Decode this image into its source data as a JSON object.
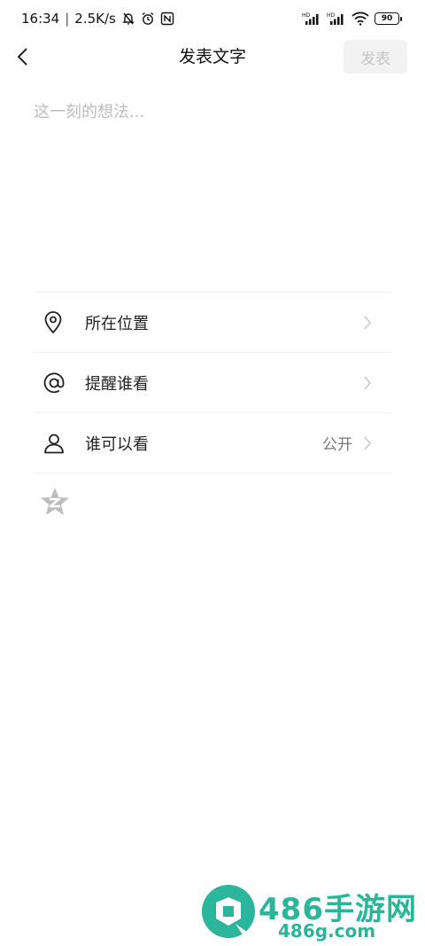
{
  "status_bar": {
    "time": "16:34",
    "network_speed": "2.5K/s",
    "battery_level": "90",
    "icons": [
      "bell-muted-icon",
      "alarm-icon",
      "nfc-icon",
      "signal-hd-icon",
      "signal-hd-icon",
      "wifi-icon",
      "battery-icon"
    ]
  },
  "header": {
    "title": "发表文字",
    "publish_label": "发表",
    "back_icon": "chevron-left-icon"
  },
  "editor": {
    "placeholder": "这一刻的想法..."
  },
  "options": [
    {
      "icon": "location-pin-icon",
      "label": "所在位置",
      "value": ""
    },
    {
      "icon": "at-sign-icon",
      "label": "提醒谁看",
      "value": ""
    },
    {
      "icon": "person-icon",
      "label": "谁可以看",
      "value": "公开"
    }
  ],
  "qzone": {
    "icon": "qzone-star-icon"
  },
  "watermark": {
    "title": "486手游网",
    "url": "486g.com"
  },
  "colors": {
    "accent": "#2bb59a",
    "publish_disabled_bg": "#f2f2f2",
    "publish_disabled_text": "#c6c6c6",
    "divider": "#efefef",
    "placeholder": "#bdbdbd"
  }
}
